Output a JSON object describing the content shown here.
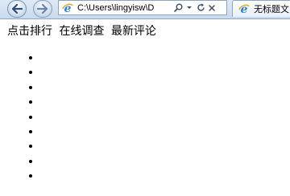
{
  "browser": {
    "address": "C:\\Users\\lingyisw\\D",
    "tab_title": "无标题文"
  },
  "page": {
    "links": [
      "点击排行",
      "在线调查",
      "最新评论"
    ],
    "list_item_count": 9
  },
  "icons": {
    "back": "back-arrow-icon",
    "forward": "forward-arrow-icon",
    "page": "ie-page-icon",
    "search": "search-icon",
    "dropdown": "chevron-down-icon",
    "refresh": "refresh-icon",
    "stop": "stop-icon"
  },
  "colors": {
    "chrome": "#c9daee",
    "ie_icon": "#2b84d6"
  }
}
